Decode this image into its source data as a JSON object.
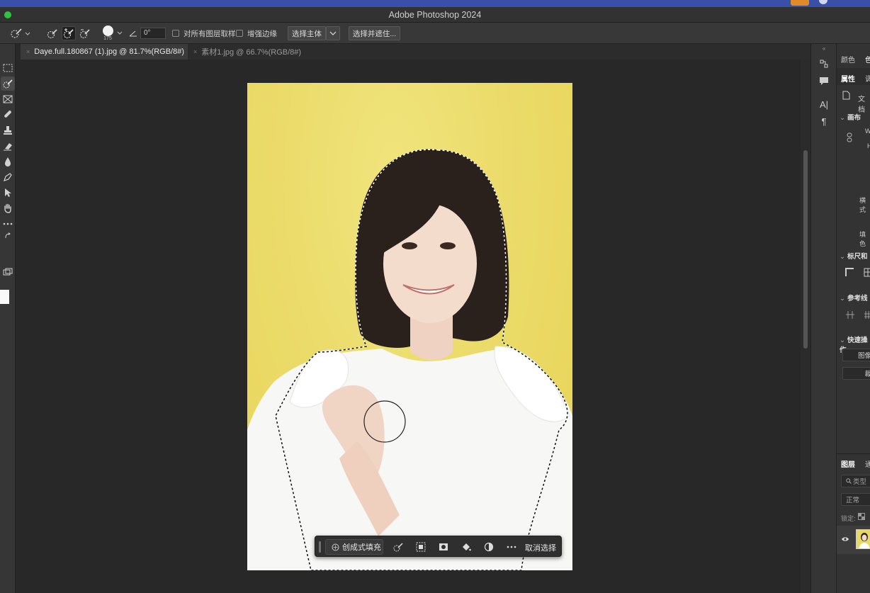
{
  "app": {
    "title": "Adobe Photoshop 2024"
  },
  "options_bar": {
    "brush_size": "175",
    "angle": "0°",
    "sample_all_layers_label": "对所有图层取样",
    "sample_all_layers_checked": false,
    "enhance_edge_label": "增强边缘",
    "enhance_edge_checked": false,
    "select_subject_label": "选择主体",
    "select_and_mask_label": "选择并遮住..."
  },
  "tabs": [
    {
      "label": "Daye.full.180867 (1).jpg @ 81.7%(RGB/8#)",
      "active": true
    },
    {
      "label": "素材1.jpg @ 66.7%(RGB/8#)",
      "active": false
    }
  ],
  "taskbar": {
    "generative_fill_label": "创成式填充",
    "deselect_label": "取消选择"
  },
  "panel": {
    "top_tabs": [
      "颜色",
      "色"
    ],
    "sub_tabs": [
      "属性",
      "调"
    ],
    "doc_label": "文档",
    "sections": {
      "canvas": "画布",
      "rulers": "标尺和",
      "guides": "参考线",
      "quick_actions": "快速操作"
    },
    "canvas_fields": {
      "w": "W",
      "h": "H",
      "orientation": "横式",
      "fill": "填色"
    },
    "quick_buttons": [
      "图像",
      "裁"
    ],
    "layers_tabs": [
      "图层",
      "通"
    ],
    "layer_search_placeholder": "类型",
    "blend_mode": "正常",
    "lock_label": "锁定:"
  },
  "colors": {
    "accent_selection": "#ffffff",
    "photo_background": "#ebdb6a",
    "app_dark": "#282828",
    "traffic_green": "#2fc43d"
  }
}
